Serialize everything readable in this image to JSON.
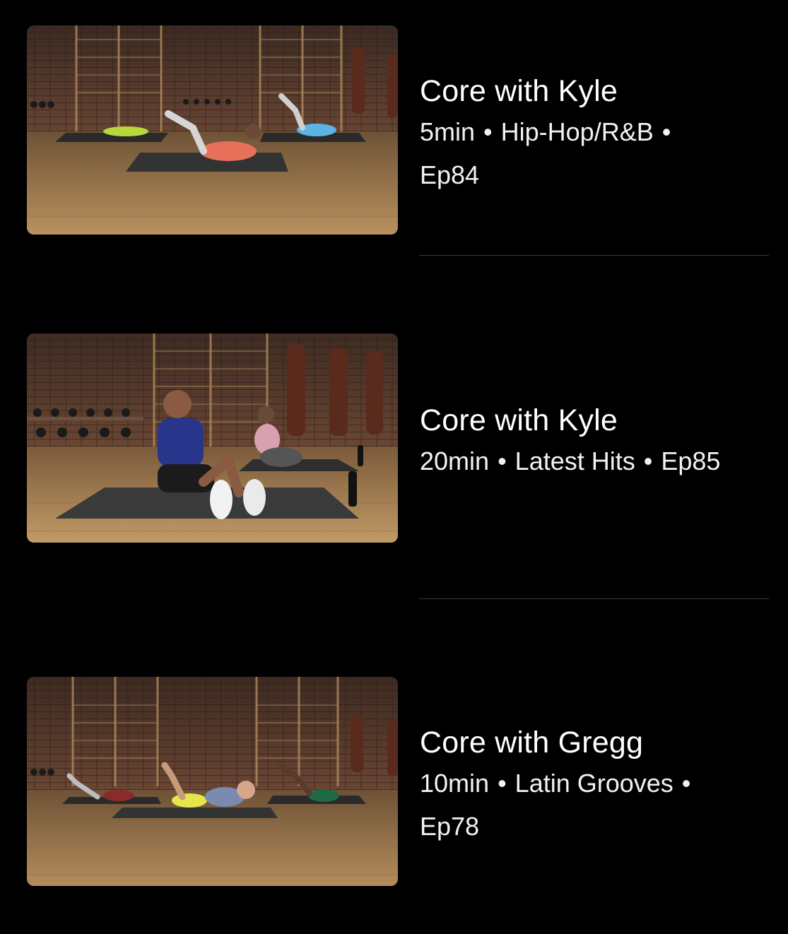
{
  "episodes": [
    {
      "title": "Core with Kyle",
      "duration": "5min",
      "genre": "Hip-Hop/R&B",
      "episode": "Ep84",
      "thumbnail": "workout-thumbnail"
    },
    {
      "title": "Core with Kyle",
      "duration": "20min",
      "genre": "Latest Hits",
      "episode": "Ep85",
      "thumbnail": "workout-thumbnail"
    },
    {
      "title": "Core with Gregg",
      "duration": "10min",
      "genre": "Latin Grooves",
      "episode": "Ep78",
      "thumbnail": "workout-thumbnail"
    }
  ],
  "separator": "•",
  "colors": {
    "background": "#000000",
    "text": "#ffffff",
    "divider": "#3a3a3c",
    "brick": "#5a3a2c",
    "floor": "#a07a52"
  }
}
